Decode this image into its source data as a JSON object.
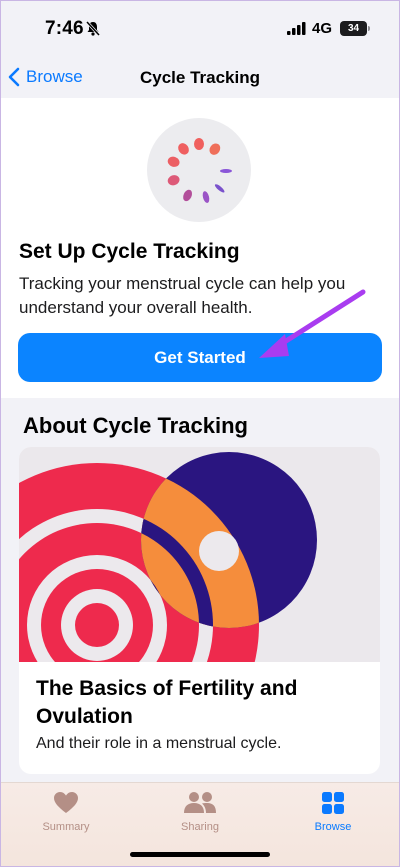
{
  "status_bar": {
    "time": "7:46",
    "network": "4G",
    "battery": "34"
  },
  "nav": {
    "back_label": "Browse",
    "title": "Cycle Tracking"
  },
  "setup": {
    "heading": "Set Up Cycle Tracking",
    "description": "Tracking your menstrual cycle can help you understand your overall health.",
    "button_label": "Get Started"
  },
  "about": {
    "heading": "About Cycle Tracking",
    "article": {
      "title": "The Basics of Fertility and Ovulation",
      "subtitle": "And their role in a menstrual cycle."
    }
  },
  "tab_bar": {
    "tabs": [
      {
        "label": "Summary",
        "icon": "heart-icon",
        "active": false
      },
      {
        "label": "Sharing",
        "icon": "people-icon",
        "active": false
      },
      {
        "label": "Browse",
        "icon": "grid-icon",
        "active": true
      }
    ]
  },
  "colors": {
    "accent": "#0b84ff",
    "annotation_arrow": "#a93cf0",
    "art_red": "#ee2a4d",
    "art_orange": "#f58d3c",
    "art_navy": "#2a1580"
  }
}
